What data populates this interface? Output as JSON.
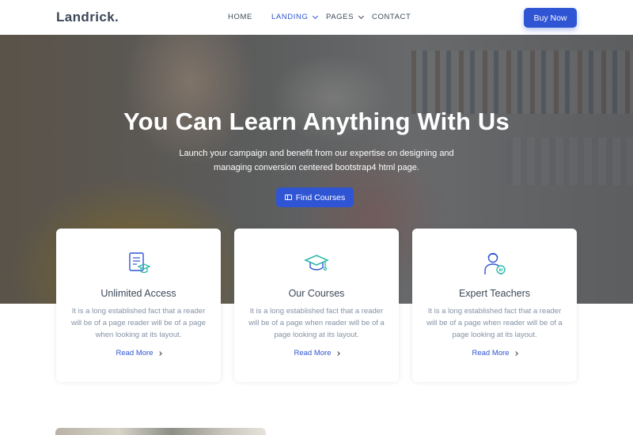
{
  "brand": {
    "name": "Landrick."
  },
  "nav": {
    "items": [
      {
        "label": "HOME",
        "active": false,
        "dropdown": false
      },
      {
        "label": "LANDING",
        "active": true,
        "dropdown": true
      },
      {
        "label": "PAGES",
        "active": false,
        "dropdown": true
      },
      {
        "label": "CONTACT",
        "active": false,
        "dropdown": false
      }
    ],
    "cta_label": "Buy Now"
  },
  "hero": {
    "title": "You Can Learn Anything With Us",
    "subtitle_line1": "Launch your campaign and benefit from our expertise on designing and",
    "subtitle_line2": "managing conversion centered bootstrap4 html page.",
    "button_label": "Find Courses",
    "button_icon": "book-icon"
  },
  "features": [
    {
      "icon": "certificate-document-icon",
      "title": "Unlimited Access",
      "text": "It is a long established fact that a reader will be of a page reader will be of a page when looking at its layout.",
      "link_label": "Read More"
    },
    {
      "icon": "graduation-cap-icon",
      "title": "Our Courses",
      "text": "It is a long established fact that a reader will be of a page when reader will be of a page looking at its layout.",
      "link_label": "Read More"
    },
    {
      "icon": "teacher-avatar-icon",
      "title": "Expert Teachers",
      "text": "It is a long established fact that a reader will be of a page when reader will be of a page looking at its layout.",
      "link_label": "Read More"
    }
  ],
  "colors": {
    "primary": "#2f55d4",
    "icon_accent": "#2eb8a8",
    "heading": "#3c4858",
    "muted": "#8492a6"
  }
}
